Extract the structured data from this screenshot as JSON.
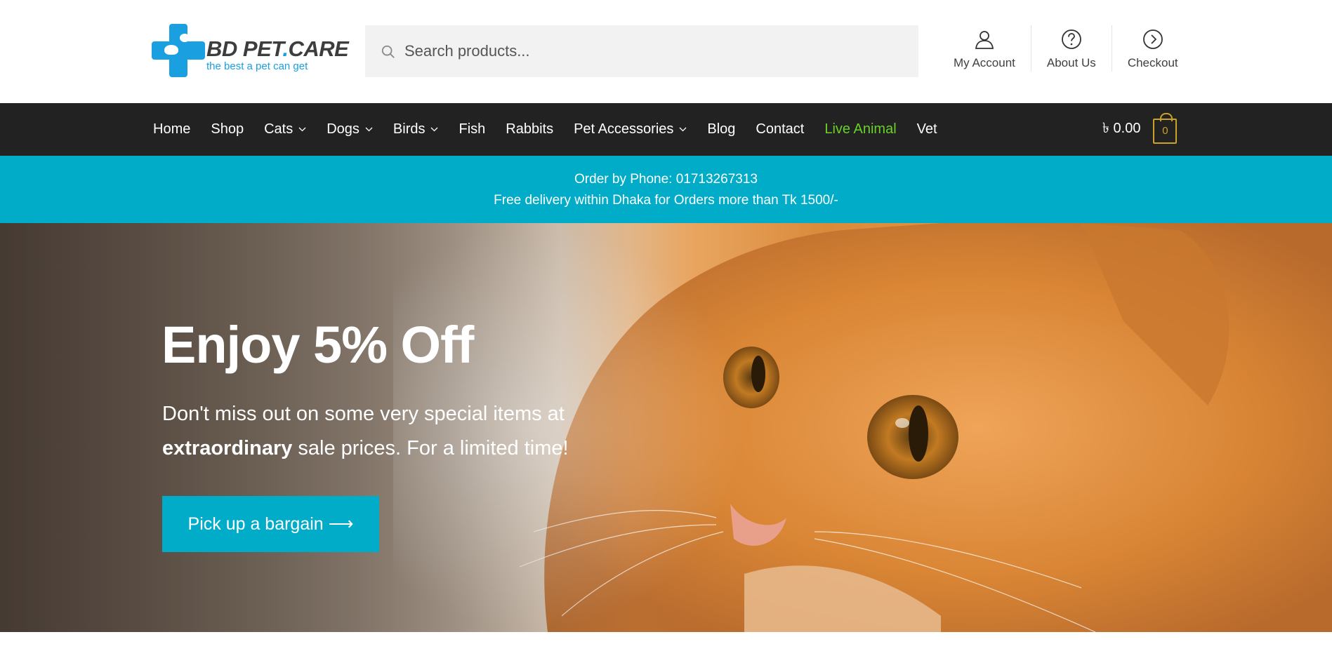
{
  "brand": {
    "logo_name_prefix": "BD PET",
    "logo_name_dot": ".",
    "logo_name_suffix": "CARE",
    "tagline": "the best a pet can get",
    "accent_color": "#1aa0e0"
  },
  "search": {
    "placeholder": "Search products...",
    "value": ""
  },
  "header_links": [
    {
      "label": "My Account",
      "icon": "user-icon"
    },
    {
      "label": "About Us",
      "icon": "help-circle-icon"
    },
    {
      "label": "Checkout",
      "icon": "arrow-circle-right-icon"
    }
  ],
  "nav": {
    "items": [
      {
        "label": "Home",
        "dropdown": false
      },
      {
        "label": "Shop",
        "dropdown": false
      },
      {
        "label": "Cats",
        "dropdown": true
      },
      {
        "label": "Dogs",
        "dropdown": true
      },
      {
        "label": "Birds",
        "dropdown": true
      },
      {
        "label": "Fish",
        "dropdown": false
      },
      {
        "label": "Rabbits",
        "dropdown": false
      },
      {
        "label": "Pet Accessories",
        "dropdown": true
      },
      {
        "label": "Blog",
        "dropdown": false
      },
      {
        "label": "Contact",
        "dropdown": false
      },
      {
        "label": "Live Animal",
        "dropdown": false,
        "highlight_color": "#69d128"
      },
      {
        "label": "Vet",
        "dropdown": false
      }
    ],
    "background_color": "#222222"
  },
  "cart": {
    "total": "৳ 0.00",
    "count": "0",
    "icon": "shopping-bag-icon",
    "accent_color": "#c9a227"
  },
  "infobar": {
    "line1": "Order by Phone: 01713267313",
    "line2": "Free delivery within Dhaka for Orders more than Tk 1500/-",
    "background_color": "#00acc8"
  },
  "hero": {
    "title": "Enjoy 5% Off",
    "text_part1": "Don't miss out on some very special items at ",
    "text_bold": "extraordinary",
    "text_part2": " sale prices. For a limited time!",
    "button_label": "Pick up a bargain ⟶",
    "button_color": "#00acc8",
    "image": "orange-kitten-photo"
  }
}
